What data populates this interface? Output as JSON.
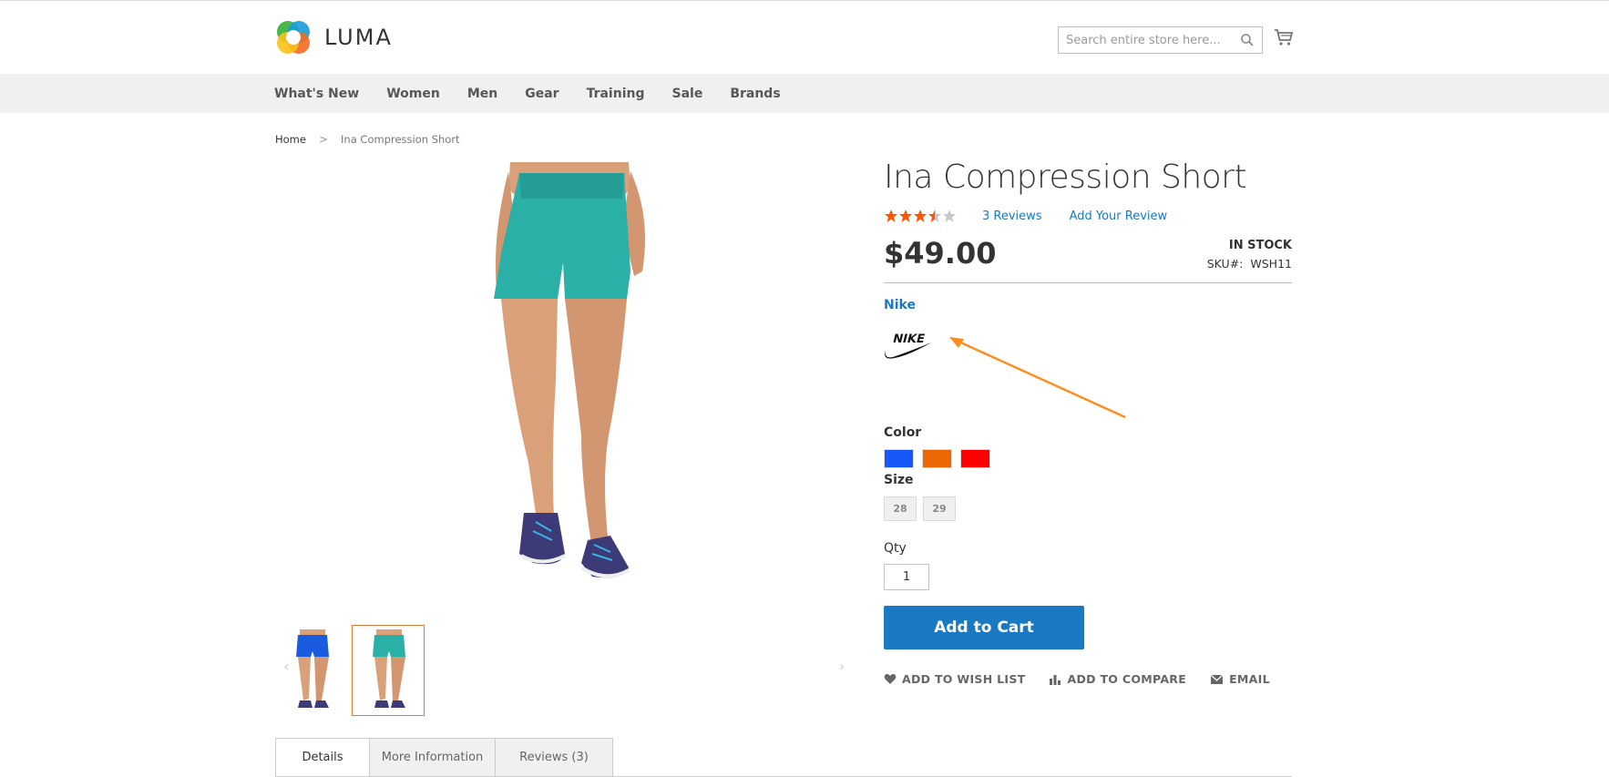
{
  "header": {
    "logo_text": "LUMA",
    "search_placeholder": "Search entire store here...",
    "icons": {
      "search": "search-icon",
      "cart": "cart-icon"
    }
  },
  "nav": {
    "items": [
      "What's New",
      "Women",
      "Men",
      "Gear",
      "Training",
      "Sale",
      "Brands"
    ]
  },
  "breadcrumb": {
    "home": "Home",
    "separator": ">",
    "current": "Ina Compression Short"
  },
  "product": {
    "title": "Ina Compression Short",
    "rating_fraction": 0.7,
    "reviews_label": "3 Reviews",
    "add_review_label": "Add Your Review",
    "price": "$49.00",
    "stock": "IN STOCK",
    "sku_label": "SKU#:",
    "sku_value": "WSH11",
    "brand": "Nike",
    "brand_logo_text": "NIKE",
    "color_label": "Color",
    "colors": [
      "#1857f7",
      "#eb6703",
      "#ff0000"
    ],
    "size_label": "Size",
    "sizes": [
      "28",
      "29"
    ],
    "qty_label": "Qty",
    "qty_value": "1",
    "add_to_cart_label": "Add to Cart",
    "actions": {
      "wishlist": "ADD TO WISH LIST",
      "compare": "ADD TO COMPARE",
      "email": "EMAIL"
    }
  },
  "tabs": [
    "Details",
    "More Information",
    "Reviews (3)"
  ],
  "colors": {
    "accent_blue": "#1979c3",
    "star": "#ff5501",
    "thumb_active_border": "#e57a3a",
    "annotation_arrow": "#ff8c1a",
    "short_teal": "#2bb0a8"
  }
}
